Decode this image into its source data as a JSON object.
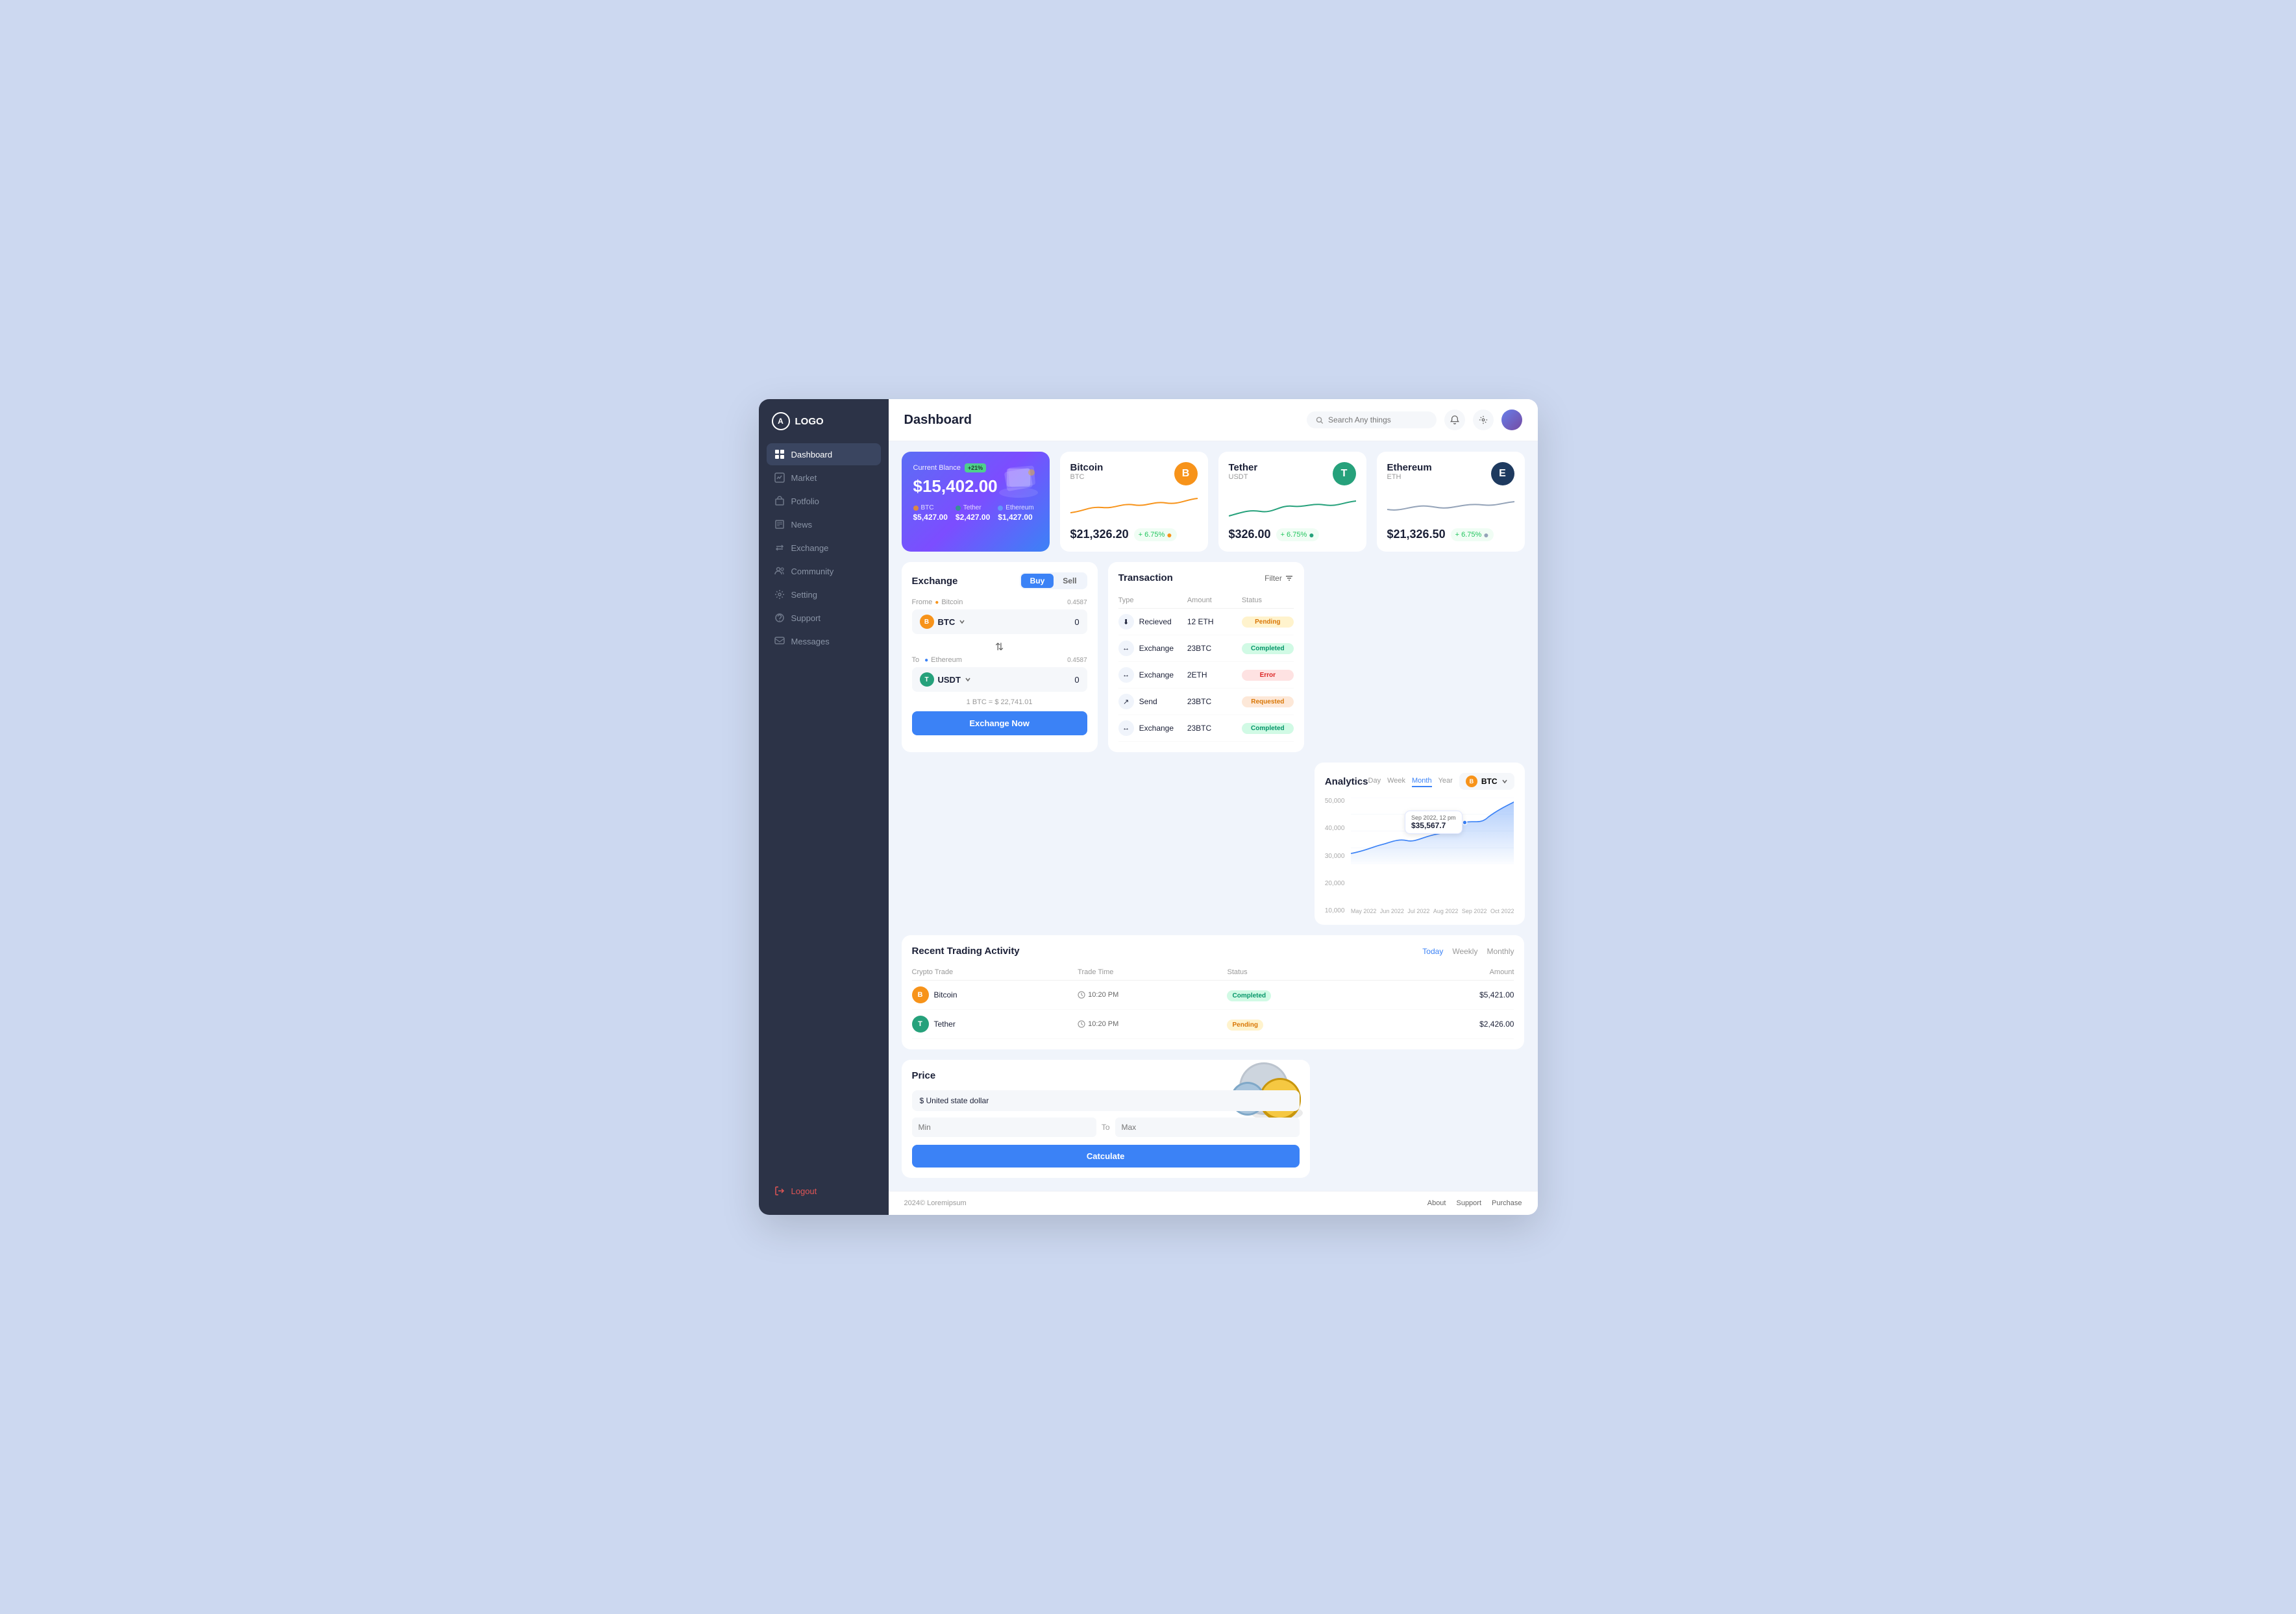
{
  "app": {
    "logo": "LOGO",
    "logo_icon": "A"
  },
  "sidebar": {
    "items": [
      {
        "id": "dashboard",
        "label": "Dashboard",
        "active": true
      },
      {
        "id": "market",
        "label": "Market",
        "active": false
      },
      {
        "id": "portfolio",
        "label": "Potfolio",
        "active": false
      },
      {
        "id": "news",
        "label": "News",
        "active": false
      },
      {
        "id": "exchange",
        "label": "Exchange",
        "active": false
      },
      {
        "id": "community",
        "label": "Community",
        "active": false
      },
      {
        "id": "setting",
        "label": "Setting",
        "active": false
      },
      {
        "id": "support",
        "label": "Support",
        "active": false
      },
      {
        "id": "messages",
        "label": "Messages",
        "active": false
      }
    ],
    "logout_label": "Logout"
  },
  "header": {
    "title": "Dashboard",
    "search_placeholder": "Search Any things"
  },
  "balance_card": {
    "label": "Current Blance",
    "badge": "+21%",
    "amount": "$15,402.00",
    "coins": [
      {
        "symbol": "BTC",
        "color": "#f7931a",
        "value": "$5,427.00"
      },
      {
        "symbol": "Tether",
        "color": "#26a17b",
        "value": "$2,427.00"
      },
      {
        "symbol": "Ethereum",
        "color": "#3b82f6",
        "value": "$1,427.00"
      }
    ]
  },
  "bitcoin_card": {
    "name": "Bitcoin",
    "symbol": "BTC",
    "icon_color": "#f7931a",
    "icon_letter": "B",
    "price": "$21,326.20",
    "change": "+ 6.75%",
    "change_color": "#22c55e"
  },
  "tether_card": {
    "name": "Tether",
    "symbol": "USDT",
    "icon_color": "#26a17b",
    "icon_letter": "T",
    "price": "$326.00",
    "change": "+ 6.75%",
    "change_color": "#22c55e"
  },
  "ethereum_card": {
    "name": "Ethereum",
    "symbol": "ETH",
    "icon_color": "#1e3a5f",
    "icon_letter": "E",
    "price": "$21,326.50",
    "change": "+ 6.75%",
    "change_color": "#22c55e"
  },
  "exchange": {
    "title": "Exchange",
    "buy_label": "Buy",
    "sell_label": "Sell",
    "from_label": "Frome",
    "from_coin": "Bitcoin",
    "from_amount": "0.4587",
    "from_currency": "BTC",
    "to_label": "To",
    "to_coin": "Ethereum",
    "to_amount": "0.4587",
    "to_currency": "USDT",
    "input_from": "0",
    "input_to": "0",
    "rate": "1 BTC = $ 22,741.01",
    "button_label": "Exchange Now"
  },
  "transaction": {
    "title": "Transaction",
    "filter_label": "Filter",
    "columns": [
      "Type",
      "Amount",
      "Status"
    ],
    "rows": [
      {
        "type": "Recieved",
        "amount": "12 ETH",
        "status": "Pending",
        "status_type": "pending"
      },
      {
        "type": "Exchange",
        "amount": "23BTC",
        "status": "Completed",
        "status_type": "completed"
      },
      {
        "type": "Exchange",
        "amount": "2ETH",
        "status": "Error",
        "status_type": "error"
      },
      {
        "type": "Send",
        "amount": "23BTC",
        "status": "Requested",
        "status_type": "requested"
      },
      {
        "type": "Exchange",
        "amount": "23BTC",
        "status": "Completed",
        "status_type": "completed"
      }
    ]
  },
  "analytics": {
    "title": "Analytics",
    "time_tabs": [
      "Day",
      "Week",
      "Month",
      "Year"
    ],
    "active_tab": "Month",
    "coin": "BTC",
    "tooltip_date": "Sep 2022, 12 pm",
    "tooltip_value": "$35,567.7",
    "y_labels": [
      "50,000",
      "40,000",
      "30,000",
      "20,000",
      "10,000"
    ],
    "x_labels": [
      "May 2022",
      "Jun 2022",
      "Jul 2022",
      "Aug 2022",
      "Sep 2022",
      "Oct 2022"
    ]
  },
  "recent_trading": {
    "title": "Recent Trading Activity",
    "period_tabs": [
      "Today",
      "Weekly",
      "Monthly"
    ],
    "active_period": "Today",
    "columns": [
      "Crypto Trade",
      "Trade Time",
      "Status",
      "Amount"
    ],
    "rows": [
      {
        "coin": "Bitcoin",
        "coin_color": "#f7931a",
        "coin_letter": "B",
        "time": "10:20 PM",
        "status": "Completed",
        "status_type": "completed",
        "amount": "$5,421.00"
      },
      {
        "coin": "Tether",
        "coin_color": "#26a17b",
        "coin_letter": "T",
        "time": "10:20 PM",
        "status": "Pending",
        "status_type": "pending",
        "amount": "$2,426.00"
      }
    ]
  },
  "price": {
    "title": "Price",
    "currency_label": "$ United state dollar",
    "min_placeholder": "Min",
    "to_label": "To",
    "max_placeholder": "Max",
    "button_label": "Catculate"
  },
  "footer": {
    "copyright": "2024© Loremipsum",
    "links": [
      "About",
      "Support",
      "Purchase"
    ]
  }
}
